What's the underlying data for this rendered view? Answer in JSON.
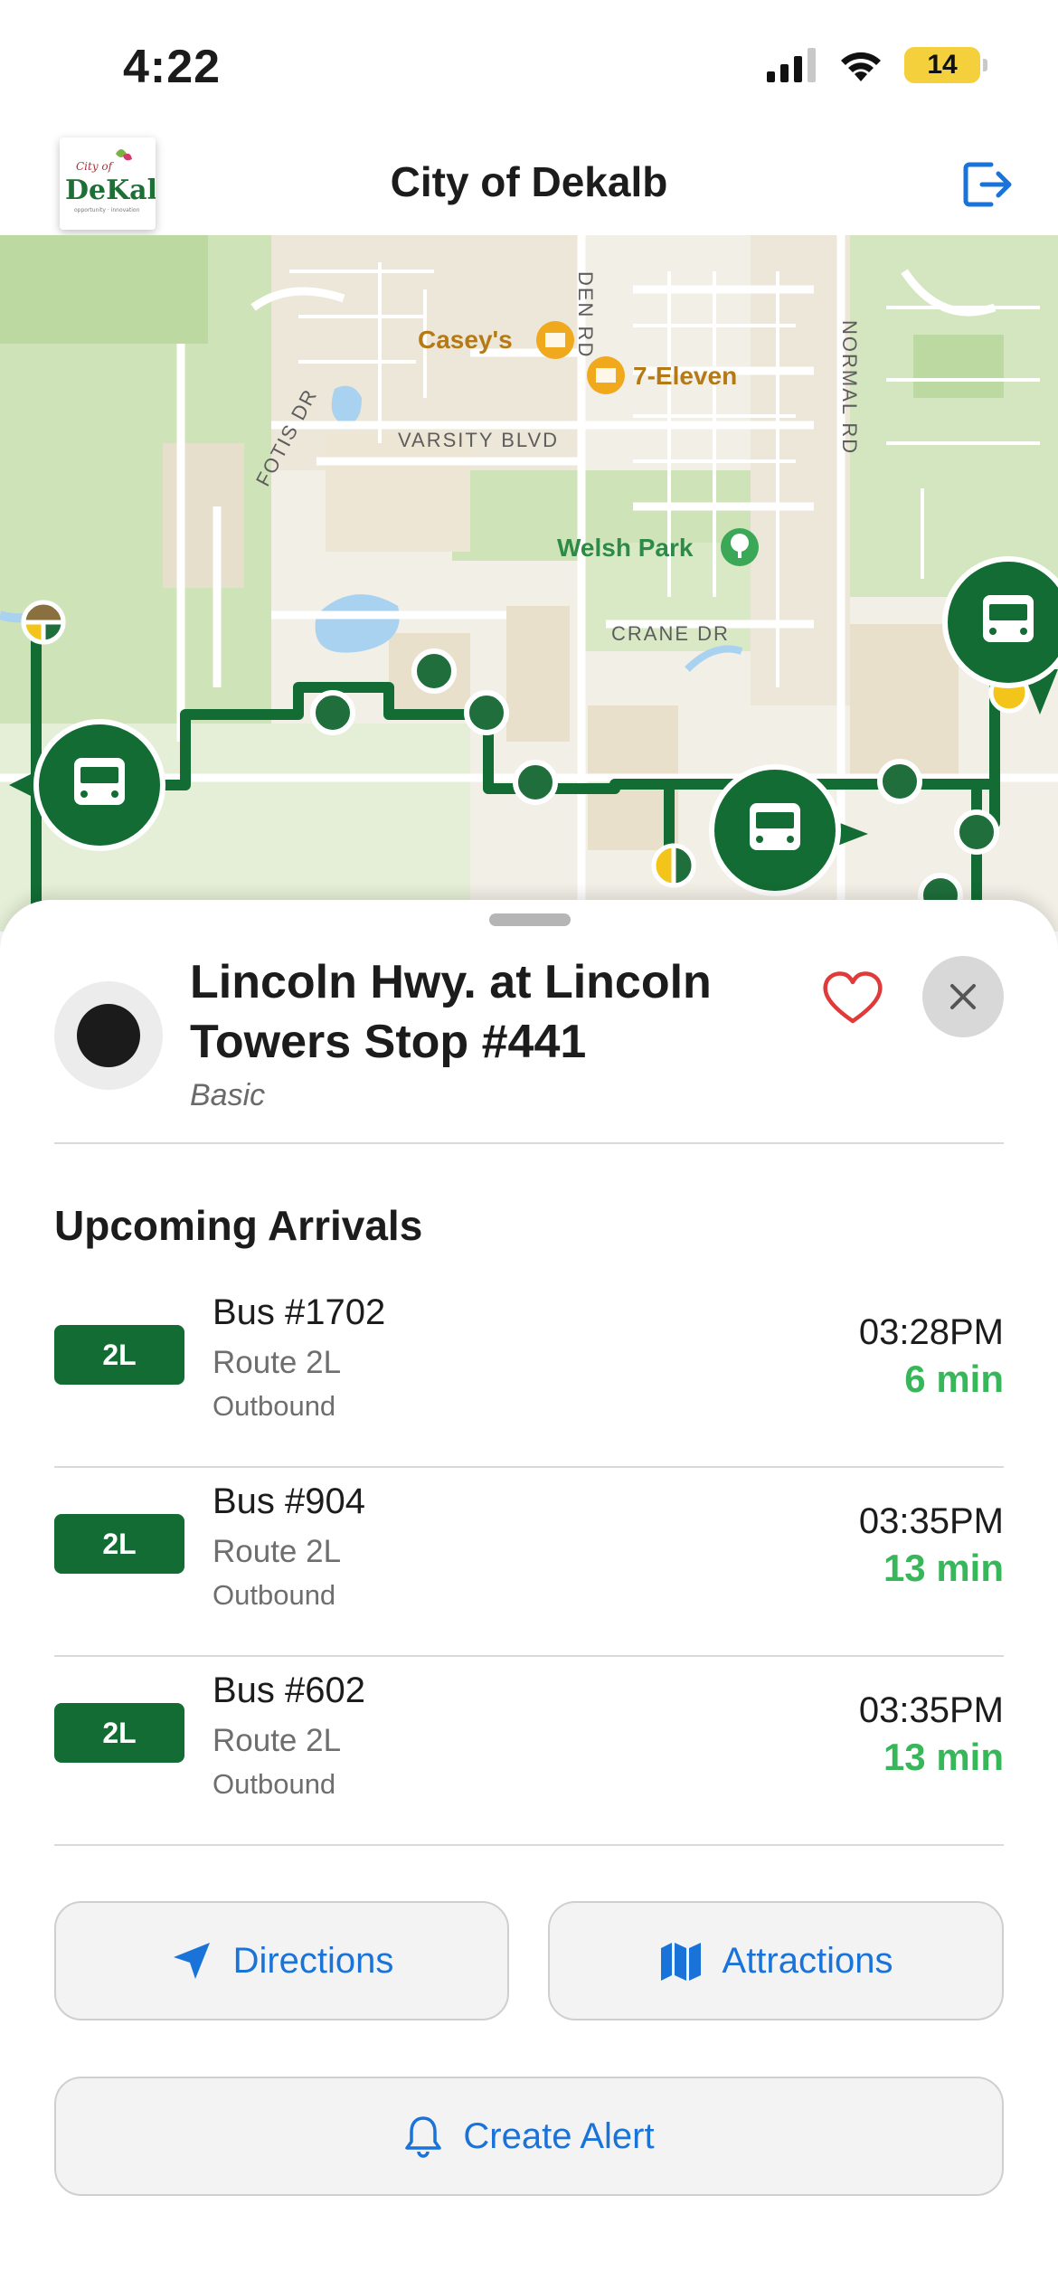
{
  "status_bar": {
    "time": "4:22",
    "battery": "14"
  },
  "header": {
    "title": "City of Dekalb",
    "logo_text_top": "City of",
    "logo_text_main": "DeKalb"
  },
  "map": {
    "street_labels": [
      "DEN RD",
      "FOTIS DR",
      "VARSITY BLVD",
      "NORMAL RD",
      "CRANE DR"
    ],
    "pois": [
      "Casey's",
      "7-Eleven",
      "Welsh Park"
    ],
    "route_color": "#136c33",
    "stop_color": "#1f6e3b"
  },
  "stop": {
    "title": "Lincoln Hwy. at Lincoln Towers Stop #441",
    "type": "Basic"
  },
  "upcoming": {
    "title": "Upcoming Arrivals",
    "items": [
      {
        "route": "2L",
        "bus": "Bus #1702",
        "route_name": "Route 2L",
        "direction": "Outbound",
        "time": "03:28PM",
        "eta": "6 min"
      },
      {
        "route": "2L",
        "bus": "Bus #904",
        "route_name": "Route 2L",
        "direction": "Outbound",
        "time": "03:35PM",
        "eta": "13 min"
      },
      {
        "route": "2L",
        "bus": "Bus #602",
        "route_name": "Route 2L",
        "direction": "Outbound",
        "time": "03:35PM",
        "eta": "13 min"
      }
    ]
  },
  "actions": {
    "directions": "Directions",
    "attractions": "Attractions",
    "create_alert": "Create Alert"
  },
  "colors": {
    "accent": "#1a73d9",
    "brand_green": "#136c33",
    "eta_green": "#37b75a"
  }
}
